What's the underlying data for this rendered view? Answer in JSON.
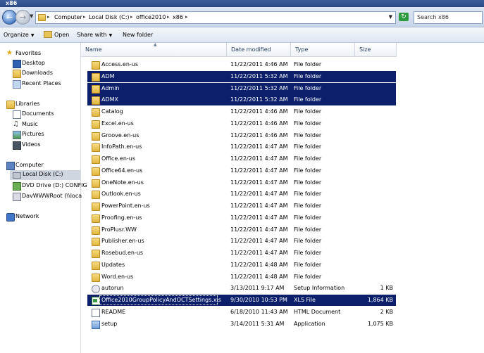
{
  "window": {
    "title": "x86"
  },
  "address": {
    "crumbs": [
      "Computer",
      "Local Disk (C:)",
      "office2010",
      "x86"
    ],
    "search_placeholder": "Search x86"
  },
  "toolbar": {
    "organize": "Organize",
    "open": "Open",
    "share_with": "Share with",
    "new_folder": "New folder"
  },
  "nav": {
    "favorites": "Favorites",
    "desktop": "Desktop",
    "downloads": "Downloads",
    "recent_places": "Recent Places",
    "libraries": "Libraries",
    "documents": "Documents",
    "music": "Music",
    "pictures": "Pictures",
    "videos": "Videos",
    "computer": "Computer",
    "local_disk": "Local Disk (C:)",
    "dvd_drive": "DVD Drive (D:) CONFIG",
    "davwwwroot": "DavWWWRoot (\\\\loca",
    "network": "Network"
  },
  "columns": {
    "name": "Name",
    "date": "Date modified",
    "type": "Type",
    "size": "Size"
  },
  "files": [
    {
      "name": "Access.en-us",
      "date": "11/22/2011 4:46 AM",
      "type": "File folder",
      "size": "",
      "icon": "folder",
      "selected": false
    },
    {
      "name": "ADM",
      "date": "11/22/2011 5:32 AM",
      "type": "File folder",
      "size": "",
      "icon": "folder",
      "selected": true
    },
    {
      "name": "Admin",
      "date": "11/22/2011 5:32 AM",
      "type": "File folder",
      "size": "",
      "icon": "folder",
      "selected": true
    },
    {
      "name": "ADMX",
      "date": "11/22/2011 5:32 AM",
      "type": "File folder",
      "size": "",
      "icon": "folder",
      "selected": true
    },
    {
      "name": "Catalog",
      "date": "11/22/2011 4:46 AM",
      "type": "File folder",
      "size": "",
      "icon": "folder",
      "selected": false
    },
    {
      "name": "Excel.en-us",
      "date": "11/22/2011 4:46 AM",
      "type": "File folder",
      "size": "",
      "icon": "folder",
      "selected": false
    },
    {
      "name": "Groove.en-us",
      "date": "11/22/2011 4:46 AM",
      "type": "File folder",
      "size": "",
      "icon": "folder",
      "selected": false
    },
    {
      "name": "InfoPath.en-us",
      "date": "11/22/2011 4:47 AM",
      "type": "File folder",
      "size": "",
      "icon": "folder",
      "selected": false
    },
    {
      "name": "Office.en-us",
      "date": "11/22/2011 4:47 AM",
      "type": "File folder",
      "size": "",
      "icon": "folder",
      "selected": false
    },
    {
      "name": "Office64.en-us",
      "date": "11/22/2011 4:47 AM",
      "type": "File folder",
      "size": "",
      "icon": "folder",
      "selected": false
    },
    {
      "name": "OneNote.en-us",
      "date": "11/22/2011 4:47 AM",
      "type": "File folder",
      "size": "",
      "icon": "folder",
      "selected": false
    },
    {
      "name": "Outlook.en-us",
      "date": "11/22/2011 4:47 AM",
      "type": "File folder",
      "size": "",
      "icon": "folder",
      "selected": false
    },
    {
      "name": "PowerPoint.en-us",
      "date": "11/22/2011 4:47 AM",
      "type": "File folder",
      "size": "",
      "icon": "folder",
      "selected": false
    },
    {
      "name": "Proofing.en-us",
      "date": "11/22/2011 4:47 AM",
      "type": "File folder",
      "size": "",
      "icon": "folder",
      "selected": false
    },
    {
      "name": "ProPlusr.WW",
      "date": "11/22/2011 4:47 AM",
      "type": "File folder",
      "size": "",
      "icon": "folder",
      "selected": false
    },
    {
      "name": "Publisher.en-us",
      "date": "11/22/2011 4:47 AM",
      "type": "File folder",
      "size": "",
      "icon": "folder",
      "selected": false
    },
    {
      "name": "Rosebud.en-us",
      "date": "11/22/2011 4:47 AM",
      "type": "File folder",
      "size": "",
      "icon": "folder",
      "selected": false
    },
    {
      "name": "Updates",
      "date": "11/22/2011 4:48 AM",
      "type": "File folder",
      "size": "",
      "icon": "folder",
      "selected": false
    },
    {
      "name": "Word.en-us",
      "date": "11/22/2011 4:48 AM",
      "type": "File folder",
      "size": "",
      "icon": "folder",
      "selected": false
    },
    {
      "name": "autorun",
      "date": "3/13/2011 9:17 AM",
      "type": "Setup Information",
      "size": "1 KB",
      "icon": "gear",
      "selected": false
    },
    {
      "name": "Office2010GroupPolicyAndOCTSettings.xls",
      "date": "9/30/2010 10:53 PM",
      "type": "XLS File",
      "size": "1,864 KB",
      "icon": "xls",
      "selected": true
    },
    {
      "name": "README",
      "date": "6/18/2010 11:43 AM",
      "type": "HTML Document",
      "size": "2 KB",
      "icon": "doc",
      "selected": false
    },
    {
      "name": "setup",
      "date": "3/14/2011 5:31 AM",
      "type": "Application",
      "size": "1,075 KB",
      "icon": "app",
      "selected": false
    }
  ],
  "colors": {
    "selection": "#0b1f6b",
    "titlebar": "#2a4a86"
  }
}
